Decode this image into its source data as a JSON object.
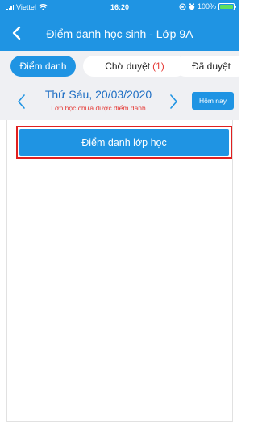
{
  "status_bar": {
    "carrier": "Viettel",
    "time": "16:20",
    "battery": "100%",
    "battery_color": "#5ee05e"
  },
  "header": {
    "title": "Điểm danh học sinh - Lớp 9A",
    "back_icon": "chevron-left-icon",
    "background": "#1f94e3"
  },
  "tabs": [
    {
      "label": "Điểm danh",
      "active": true
    },
    {
      "label": "Chờ duyệt",
      "count": "(1)",
      "active": false
    },
    {
      "label": "Đã duyệt",
      "active": false
    }
  ],
  "date_bar": {
    "date": "Thứ Sáu, 20/03/2020",
    "status": "Lớp học chưa được điểm danh",
    "today_label": "Hôm nay",
    "status_color": "#e53935"
  },
  "main": {
    "attend_button_label": "Điểm danh lớp học",
    "highlight_color": "#e02020"
  }
}
